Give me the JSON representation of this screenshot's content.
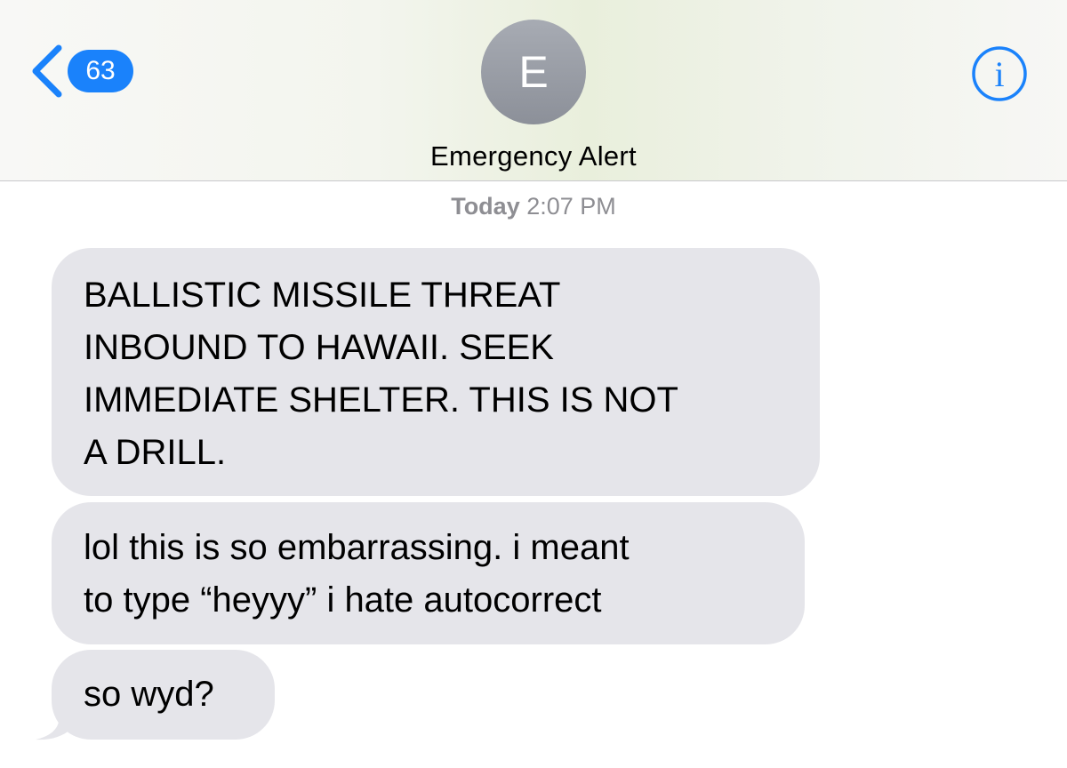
{
  "nav": {
    "back_badge": "63",
    "contact_initial": "E",
    "contact_name": "Emergency Alert",
    "info_glyph": "i",
    "back_icon": "chevron-left-icon",
    "info_icon": "info-circle-icon"
  },
  "timestamp": {
    "day": "Today",
    "time": "2:07 PM"
  },
  "messages": [
    {
      "lines": [
        "BALLISTIC MISSILE THREAT",
        "INBOUND TO HAWAII. SEEK",
        "IMMEDIATE SHELTER. THIS IS NOT",
        "A DRILL."
      ]
    },
    {
      "lines": [
        "lol this is so embarrassing. i meant",
        "to type “heyyy” i hate autocorrect"
      ]
    },
    {
      "lines": [
        "so wyd?"
      ]
    }
  ],
  "colors": {
    "accent": "#1a82fb",
    "incoming_bubble": "#e5e5ea",
    "avatar": "#9a9ea6",
    "timestamp": "#8e8e93"
  }
}
